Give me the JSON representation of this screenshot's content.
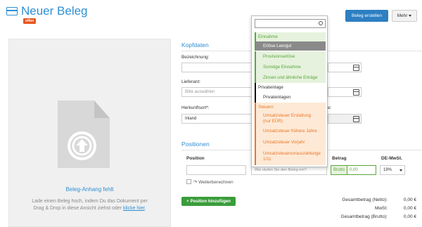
{
  "header": {
    "title": "Neuer Beleg",
    "status_badge": "offen",
    "create_button": "Beleg erstellen",
    "more_button": "Mehr"
  },
  "attachment": {
    "missing_title": "Beleg-Anhang fehlt",
    "help_line1": "Lade einen Beleg hoch, indem Du das Dokument per",
    "help_line2": "Drag & Drop in diese Ansicht ziehst oder",
    "help_link": "klicke hier",
    "help_end": "."
  },
  "kopfdaten": {
    "section_title": "Kopfdaten",
    "bezeichnung_label": "Bezeichnung:",
    "bezeichnung_value": "",
    "lieferant_label": "Lieferant:",
    "lieferant_placeholder": "Bitte auswählen",
    "herkunft_label": "Herkunftsort*:",
    "herkunft_value": "Inland",
    "right_label_partial": "e:"
  },
  "positionen": {
    "section_title": "Positionen",
    "col_position": "Position",
    "col_betrag": "Betrag",
    "col_mwst": "DE-MwSt.",
    "position_value": "",
    "category_placeholder": "Wie stufen Sie den Beleg ein?",
    "brutto_label": "Brutto",
    "amount_value": "0,00",
    "mwst_value": "19%",
    "weiterberechnen_label": "Weiterberechnen",
    "add_button": "Position hinzufügen"
  },
  "totals": [
    {
      "label": "Gesamtbetrag (Netto):",
      "value": "0,00 €"
    },
    {
      "label": "MwSt:",
      "value": "0,00 €"
    },
    {
      "label": "Gesamtbetrag (Brutto):",
      "value": "0,00 €"
    }
  ],
  "dropdown": {
    "search_value": "",
    "groups": [
      {
        "label": "Einnahme",
        "color": "#5aa63a",
        "items": [
          "Erlöse Leergut",
          "Provisionserlöse",
          "Sonstige Einnahme",
          "Zinsen und ähnliche Erträge"
        ],
        "selected": "Erlöse Leergut"
      },
      {
        "label": "Privateinlage",
        "color": "#111111",
        "items": [
          "Privateinlagen"
        ]
      },
      {
        "label": "Steuern",
        "color": "#e8782a",
        "items": [
          "Umsatzsteuer Erstattung",
          "(nur EÜR)",
          "Umsatzsteuer frühere Jahre",
          "Umsatzsteuer Vorjahr",
          "Umsatzsteuervorauszahlunge",
          "1/11"
        ]
      }
    ]
  },
  "colors": {
    "accent_blue": "#2f8fd3",
    "badge_red": "#e8551f",
    "add_green": "#3a9d3a"
  }
}
